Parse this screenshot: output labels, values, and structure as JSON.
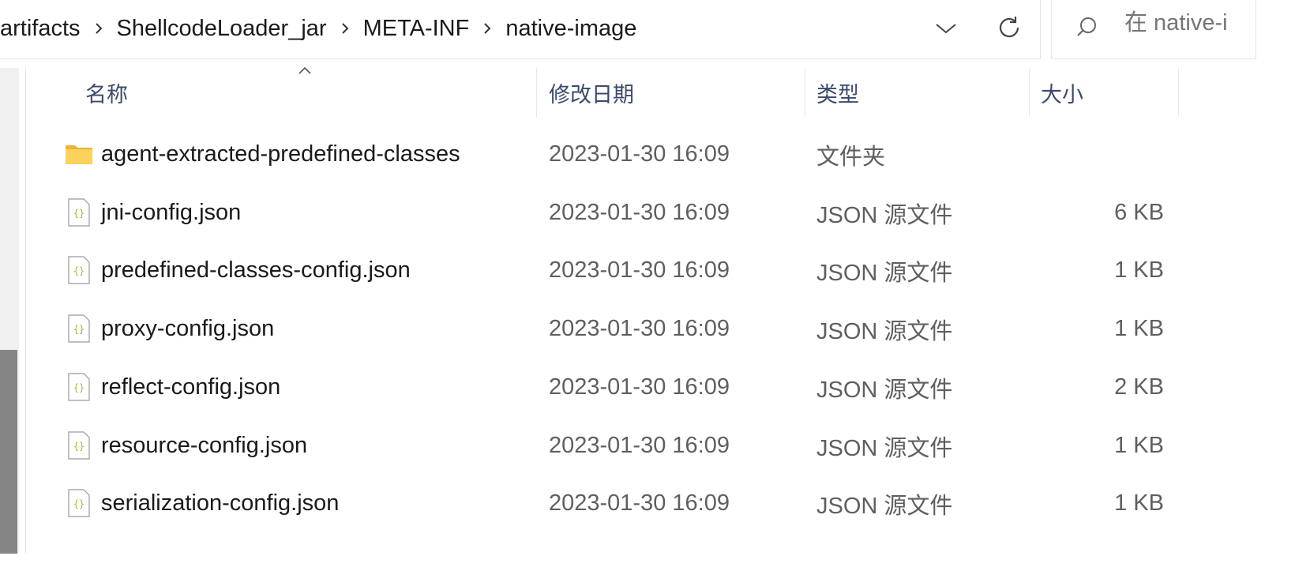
{
  "breadcrumb": [
    "artifacts",
    "ShellcodeLoader_jar",
    "META-INF",
    "native-image"
  ],
  "search": {
    "placeholder": "在 native-image 中搜索",
    "visible_text": "在 native-i"
  },
  "columns": {
    "name": "名称",
    "date": "修改日期",
    "type": "类型",
    "size": "大小"
  },
  "files": [
    {
      "name": "agent-extracted-predefined-classes",
      "date": "2023-01-30 16:09",
      "type": "文件夹",
      "size": "",
      "icon": "folder-icon"
    },
    {
      "name": "jni-config.json",
      "date": "2023-01-30 16:09",
      "type": "JSON 源文件",
      "size": "6 KB",
      "icon": "json-file-icon"
    },
    {
      "name": "predefined-classes-config.json",
      "date": "2023-01-30 16:09",
      "type": "JSON 源文件",
      "size": "1 KB",
      "icon": "json-file-icon"
    },
    {
      "name": "proxy-config.json",
      "date": "2023-01-30 16:09",
      "type": "JSON 源文件",
      "size": "1 KB",
      "icon": "json-file-icon"
    },
    {
      "name": "reflect-config.json",
      "date": "2023-01-30 16:09",
      "type": "JSON 源文件",
      "size": "2 KB",
      "icon": "json-file-icon"
    },
    {
      "name": "resource-config.json",
      "date": "2023-01-30 16:09",
      "type": "JSON 源文件",
      "size": "1 KB",
      "icon": "json-file-icon"
    },
    {
      "name": "serialization-config.json",
      "date": "2023-01-30 16:09",
      "type": "JSON 源文件",
      "size": "1 KB",
      "icon": "json-file-icon"
    }
  ],
  "colors": {
    "folder": "#f5c542",
    "json_brace": "#b5b53a",
    "header_text": "#3b4a6b",
    "scrollbar_thumb": "#858585"
  }
}
